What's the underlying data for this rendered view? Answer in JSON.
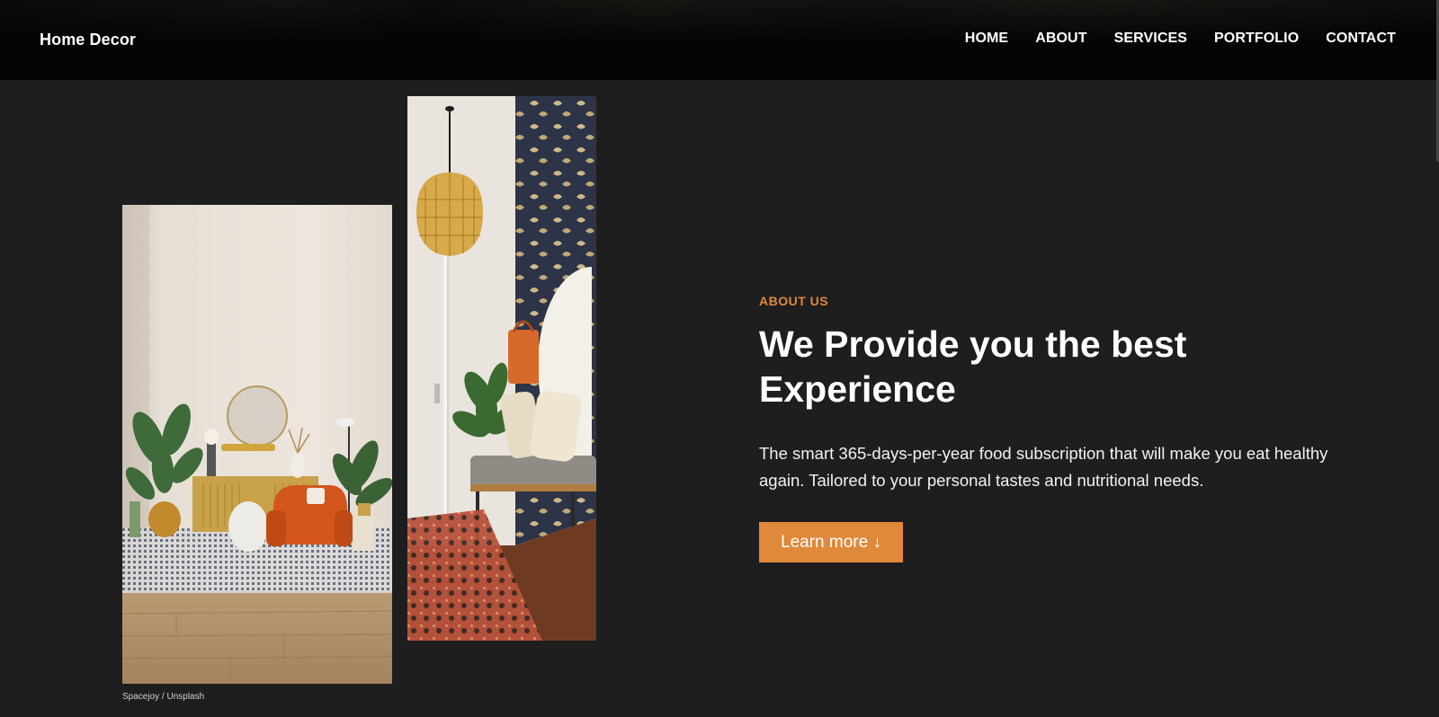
{
  "header": {
    "brand": "Home Decor",
    "nav": [
      "HOME",
      "ABOUT",
      "SERVICES",
      "PORTFOLIO",
      "CONTACT"
    ]
  },
  "about": {
    "eyebrow": "ABOUT US",
    "headline_line1": "We Provide you the best",
    "headline_line2": "Experience",
    "body": "The smart 365-days-per-year food subscription that will make you eat healthy again. Tailored to your personal tastes and nutritional needs.",
    "cta_label": "Learn more ↓"
  },
  "gallery": {
    "caption": "Spacejoy / Unsplash"
  },
  "colors": {
    "background": "#1e1e1e",
    "navbar": "#050505",
    "accent": "#e0893a",
    "text": "#ffffff"
  }
}
